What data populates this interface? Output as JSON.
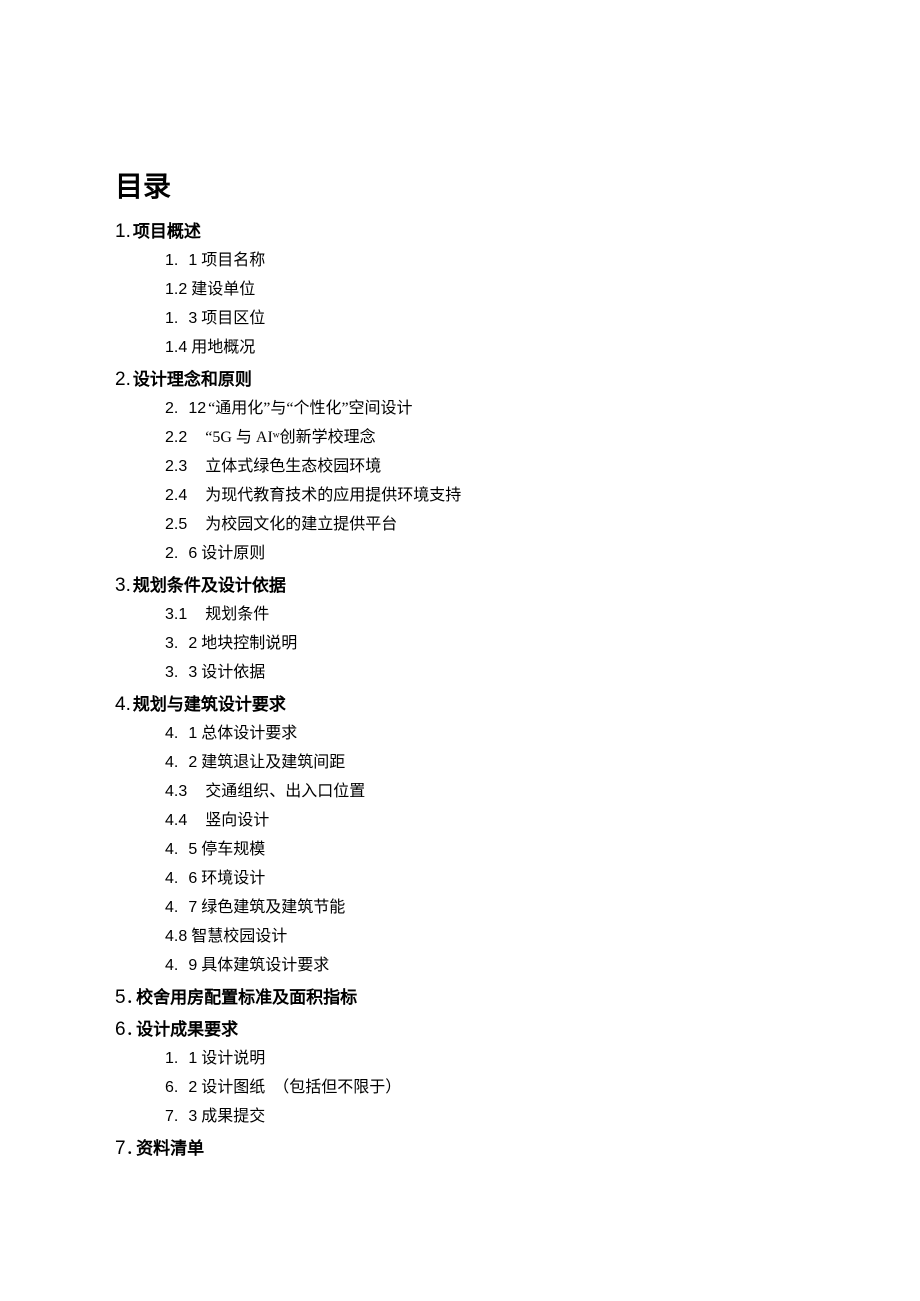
{
  "title": "目录",
  "sections": [
    {
      "num": "1.",
      "label": "项目概述",
      "items": [
        {
          "num1": "1.",
          "num2": "1",
          "text": "项目名称",
          "style": "gap",
          "txtStyle": "txt-close"
        },
        {
          "num1": "1.2",
          "num2": "",
          "text": "建设单位",
          "style": "nogap",
          "txtStyle": "txt-close"
        },
        {
          "num1": "1.",
          "num2": "3",
          "text": "项目区位",
          "style": "gap",
          "txtStyle": "txt-close"
        },
        {
          "num1": "1.4",
          "num2": "",
          "text": "用地概况",
          "style": "nogap",
          "txtStyle": "txt-close"
        }
      ]
    },
    {
      "num": "2.",
      "label": "设计理念和原则",
      "items": [
        {
          "num1": "2.",
          "num2": "12",
          "text": "“通用化”与“个性化”空间设计",
          "style": "gap",
          "txtStyle": "txt-tight"
        },
        {
          "num1": "2.2",
          "num2": "",
          "text": "“5G 与 AIʷ创新学校理念",
          "style": "nogap",
          "txtStyle": "txt-indent"
        },
        {
          "num1": "2.3",
          "num2": "",
          "text": "立体式绿色生态校园环境",
          "style": "nogap",
          "txtStyle": "txt-indent"
        },
        {
          "num1": "2.4",
          "num2": "",
          "text": "为现代教育技术的应用提供环境支持",
          "style": "nogap",
          "txtStyle": "txt-indent"
        },
        {
          "num1": "2.5",
          "num2": "",
          "text": "为校园文化的建立提供平台",
          "style": "nogap",
          "txtStyle": "txt-indent"
        },
        {
          "num1": "2.",
          "num2": "6",
          "text": "设计原则",
          "style": "gap",
          "txtStyle": "txt-close"
        }
      ]
    },
    {
      "num": "3.",
      "label": "规划条件及设计依据",
      "items": [
        {
          "num1": "3.1",
          "num2": "",
          "text": "规划条件",
          "style": "nogap",
          "txtStyle": "txt-indent"
        },
        {
          "num1": "3.",
          "num2": "2",
          "text": "地块控制说明",
          "style": "gap",
          "txtStyle": "txt-close"
        },
        {
          "num1": "3.",
          "num2": "3",
          "text": "设计依据",
          "style": "gap",
          "txtStyle": "txt-close"
        }
      ]
    },
    {
      "num": "4.",
      "label": "规划与建筑设计要求",
      "items": [
        {
          "num1": "4.",
          "num2": "1",
          "text": "总体设计要求",
          "style": "gap",
          "txtStyle": "txt-close"
        },
        {
          "num1": "4.",
          "num2": "2",
          "text": "建筑退让及建筑间距",
          "style": "gap",
          "txtStyle": "txt-close"
        },
        {
          "num1": "4.3",
          "num2": "",
          "text": "交通组织、出入口位置",
          "style": "nogap",
          "txtStyle": "txt-indent"
        },
        {
          "num1": "4.4",
          "num2": "",
          "text": "竖向设计",
          "style": "nogap",
          "txtStyle": "txt-indent"
        },
        {
          "num1": "4.",
          "num2": "5",
          "text": "停车规模",
          "style": "gap",
          "txtStyle": "txt-close"
        },
        {
          "num1": "4.",
          "num2": "6",
          "text": "环境设计",
          "style": "gap",
          "txtStyle": "txt-close"
        },
        {
          "num1": "4.",
          "num2": "7",
          "text": "绿色建筑及建筑节能",
          "style": "gap",
          "txtStyle": "txt-close"
        },
        {
          "num1": "4.8",
          "num2": "",
          "text": "智慧校园设计",
          "style": "nogap",
          "txtStyle": "txt-close"
        },
        {
          "num1": "4.",
          "num2": "9",
          "text": "具体建筑设计要求",
          "style": "gap",
          "txtStyle": "txt-close"
        }
      ]
    },
    {
      "num": "5",
      "label": ". 校舍用房配置标准及面积指标",
      "items": []
    },
    {
      "num": "6",
      "label": ". 设计成果要求",
      "items": [
        {
          "num1": "1.",
          "num2": "1",
          "text": "设计说明",
          "style": "gap",
          "txtStyle": "txt-close"
        },
        {
          "num1": "6.",
          "num2": "2",
          "text": "设计图纸　（包括但不限于）",
          "style": "gap",
          "txtStyle": "txt-close"
        },
        {
          "num1": "7.",
          "num2": "3",
          "text": "成果提交",
          "style": "gap",
          "txtStyle": "txt-close"
        }
      ]
    },
    {
      "num": "7",
      "label": ". 资料清单",
      "items": []
    }
  ]
}
